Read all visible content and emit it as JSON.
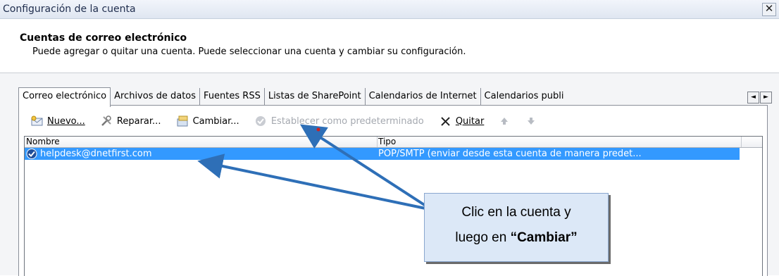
{
  "window": {
    "title": "Configuración de la cuenta",
    "close_label": "✕"
  },
  "header": {
    "heading": "Cuentas de correo electrónico",
    "description": "Puede agregar o quitar una cuenta. Puede seleccionar una cuenta y cambiar su configuración."
  },
  "tabs": [
    {
      "label": "Correo electrónico",
      "active": true
    },
    {
      "label": "Archivos de datos"
    },
    {
      "label": "Fuentes RSS"
    },
    {
      "label": "Listas de SharePoint"
    },
    {
      "label": "Calendarios de Internet"
    },
    {
      "label": "Calendarios publi"
    }
  ],
  "tab_scroll": {
    "left": "◄",
    "right": "►"
  },
  "toolbar": {
    "new_label": "Nuevo...",
    "repair_label": "Reparar...",
    "change_label": "Cambiar...",
    "default_label": "Establecer como predeterminado",
    "remove_label": "Quitar",
    "up_icon": "arrow-up-icon",
    "down_icon": "arrow-down-icon"
  },
  "list": {
    "columns": [
      "Nombre",
      "Tipo"
    ],
    "rows": [
      {
        "name": "helpdesk@dnetfirst.com",
        "type": "POP/SMTP (enviar desde esta cuenta de manera predet...",
        "selected": true
      }
    ]
  },
  "callout": {
    "line1": "Clic en la cuenta y",
    "line2_prefix": "luego en ",
    "line2_bold": "“Cambiar”"
  },
  "colors": {
    "selection": "#3399ff",
    "arrow": "#2e6fb7",
    "callout_bg": "#dce8f7"
  }
}
